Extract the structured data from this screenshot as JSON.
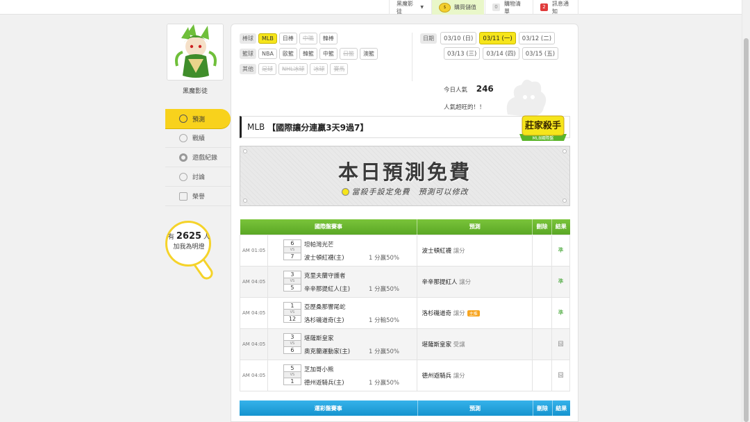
{
  "topbar": {
    "user_menu": "黑魔影徒",
    "shop": "購買儲值",
    "cart_count": "0",
    "cart_label": "購物清單",
    "notice_count": "2",
    "notice_label": "訊息通知"
  },
  "profile": {
    "username": "黑魔影徒",
    "menu": [
      "預測",
      "戰績",
      "遊戲紀錄",
      "討論",
      "榮譽"
    ],
    "fans_prefix": "有",
    "fans_count": "2625",
    "fans_unit": "人",
    "fans_text": "加我為明燈"
  },
  "filters": {
    "baseball_label": "棒球",
    "baseball": [
      {
        "label": "MLB",
        "state": "selected"
      },
      {
        "label": "日棒",
        "state": "normal"
      },
      {
        "label": "中職",
        "state": "disabled"
      },
      {
        "label": "韓棒",
        "state": "normal"
      }
    ],
    "basketball_label": "籃球",
    "basketball": [
      {
        "label": "NBA",
        "state": "normal"
      },
      {
        "label": "歐籃",
        "state": "normal"
      },
      {
        "label": "韓籃",
        "state": "normal"
      },
      {
        "label": "中籃",
        "state": "normal"
      },
      {
        "label": "日籃",
        "state": "disabled"
      },
      {
        "label": "澳籃",
        "state": "normal"
      }
    ],
    "other_label": "其他",
    "other": [
      {
        "label": "足球",
        "state": "disabled"
      },
      {
        "label": "NHL冰球",
        "state": "disabled"
      },
      {
        "label": "冰球",
        "state": "disabled"
      },
      {
        "label": "賽馬",
        "state": "disabled"
      }
    ]
  },
  "dates": {
    "label": "日期",
    "row1": [
      {
        "label": "03/10 (日)",
        "state": "normal"
      },
      {
        "label": "03/11 (一)",
        "state": "selected"
      },
      {
        "label": "03/12 (二)",
        "state": "normal"
      }
    ],
    "row2": [
      {
        "label": "03/13 (三)",
        "state": "normal"
      },
      {
        "label": "03/14 (四)",
        "state": "normal"
      },
      {
        "label": "03/15 (五)",
        "state": "normal"
      }
    ]
  },
  "popularity": {
    "label": "今日人氣",
    "value": "246",
    "comment": "人氣超旺的！！"
  },
  "title": {
    "league": "MLB",
    "text": "【國際讓分連贏3天9過7】"
  },
  "badge": {
    "main": "莊家殺手",
    "sub": "MLB國際盤"
  },
  "banner": {
    "headline": "本日預測免費",
    "sub": "當殺手設定免費　預測可以修改"
  },
  "table1": {
    "headers": [
      "國際盤賽事",
      "預測",
      "刪除",
      "結果"
    ],
    "rows": [
      {
        "time": "AM 01:05",
        "s1": "6",
        "s2": "7",
        "team1": "坦帕灣光芒",
        "team2": "波士頓紅襪(主)",
        "odds": "1 分贏50%",
        "pick": "波士頓紅襪",
        "pick_type": "讓分",
        "tag": "",
        "result": "準",
        "result_type": "ok"
      },
      {
        "time": "AM 04:05",
        "s1": "3",
        "s2": "5",
        "team1": "克里夫蘭守護者",
        "team2": "辛辛那提紅人(主)",
        "odds": "1 分贏50%",
        "pick": "辛辛那提紅人",
        "pick_type": "讓分",
        "tag": "",
        "result": "準",
        "result_type": "ok"
      },
      {
        "time": "AM 04:05",
        "s1": "1",
        "s2": "12",
        "team1": "亞歷桑那響尾蛇",
        "team2": "洛杉磯道奇(主)",
        "odds": "1 分輸50%",
        "pick": "洛杉磯道奇",
        "pick_type": "讓分",
        "tag": "主推",
        "result": "準",
        "result_type": "ok"
      },
      {
        "time": "AM 04:05",
        "s1": "3",
        "s2": "6",
        "team1": "堪薩斯皇家",
        "team2": "奧克蘭運動家(主)",
        "odds": "1 分贏50%",
        "pick": "堪薩斯皇家",
        "pick_type": "受讓",
        "tag": "",
        "result": "囧",
        "result_type": "x"
      },
      {
        "time": "AM 04:05",
        "s1": "5",
        "s2": "1",
        "team1": "芝加哥小熊",
        "team2": "德州遊騎兵(主)",
        "odds": "1 分贏50%",
        "pick": "德州遊騎兵",
        "pick_type": "讓分",
        "tag": "",
        "result": "囧",
        "result_type": "x"
      }
    ]
  },
  "table2": {
    "headers": [
      "運彩盤賽事",
      "預測",
      "刪除",
      "結果"
    ]
  }
}
